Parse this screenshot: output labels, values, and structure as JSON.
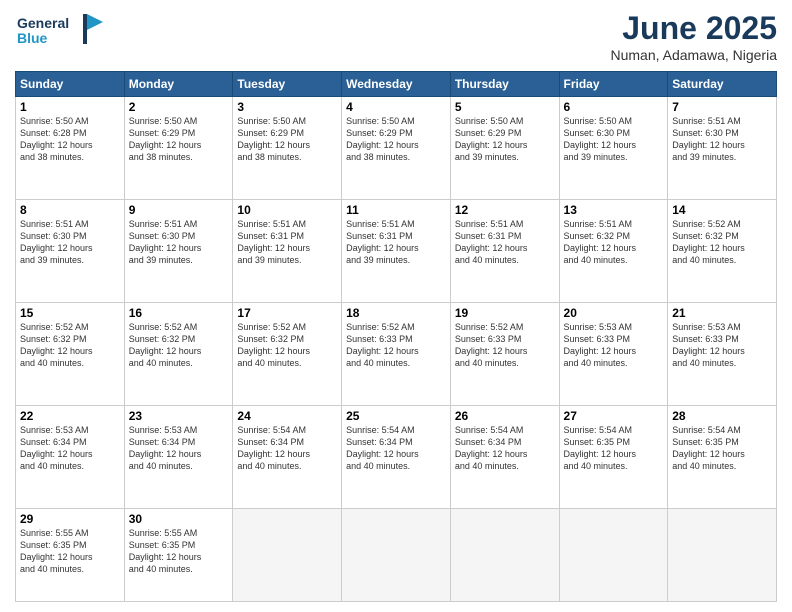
{
  "header": {
    "logo_line1": "General",
    "logo_line2": "Blue",
    "month_year": "June 2025",
    "location": "Numan, Adamawa, Nigeria"
  },
  "weekdays": [
    "Sunday",
    "Monday",
    "Tuesday",
    "Wednesday",
    "Thursday",
    "Friday",
    "Saturday"
  ],
  "weeks": [
    [
      {
        "day": "1",
        "detail": "Sunrise: 5:50 AM\nSunset: 6:28 PM\nDaylight: 12 hours\nand 38 minutes."
      },
      {
        "day": "2",
        "detail": "Sunrise: 5:50 AM\nSunset: 6:29 PM\nDaylight: 12 hours\nand 38 minutes."
      },
      {
        "day": "3",
        "detail": "Sunrise: 5:50 AM\nSunset: 6:29 PM\nDaylight: 12 hours\nand 38 minutes."
      },
      {
        "day": "4",
        "detail": "Sunrise: 5:50 AM\nSunset: 6:29 PM\nDaylight: 12 hours\nand 38 minutes."
      },
      {
        "day": "5",
        "detail": "Sunrise: 5:50 AM\nSunset: 6:29 PM\nDaylight: 12 hours\nand 39 minutes."
      },
      {
        "day": "6",
        "detail": "Sunrise: 5:50 AM\nSunset: 6:30 PM\nDaylight: 12 hours\nand 39 minutes."
      },
      {
        "day": "7",
        "detail": "Sunrise: 5:51 AM\nSunset: 6:30 PM\nDaylight: 12 hours\nand 39 minutes."
      }
    ],
    [
      {
        "day": "8",
        "detail": "Sunrise: 5:51 AM\nSunset: 6:30 PM\nDaylight: 12 hours\nand 39 minutes."
      },
      {
        "day": "9",
        "detail": "Sunrise: 5:51 AM\nSunset: 6:30 PM\nDaylight: 12 hours\nand 39 minutes."
      },
      {
        "day": "10",
        "detail": "Sunrise: 5:51 AM\nSunset: 6:31 PM\nDaylight: 12 hours\nand 39 minutes."
      },
      {
        "day": "11",
        "detail": "Sunrise: 5:51 AM\nSunset: 6:31 PM\nDaylight: 12 hours\nand 39 minutes."
      },
      {
        "day": "12",
        "detail": "Sunrise: 5:51 AM\nSunset: 6:31 PM\nDaylight: 12 hours\nand 40 minutes."
      },
      {
        "day": "13",
        "detail": "Sunrise: 5:51 AM\nSunset: 6:32 PM\nDaylight: 12 hours\nand 40 minutes."
      },
      {
        "day": "14",
        "detail": "Sunrise: 5:52 AM\nSunset: 6:32 PM\nDaylight: 12 hours\nand 40 minutes."
      }
    ],
    [
      {
        "day": "15",
        "detail": "Sunrise: 5:52 AM\nSunset: 6:32 PM\nDaylight: 12 hours\nand 40 minutes."
      },
      {
        "day": "16",
        "detail": "Sunrise: 5:52 AM\nSunset: 6:32 PM\nDaylight: 12 hours\nand 40 minutes."
      },
      {
        "day": "17",
        "detail": "Sunrise: 5:52 AM\nSunset: 6:32 PM\nDaylight: 12 hours\nand 40 minutes."
      },
      {
        "day": "18",
        "detail": "Sunrise: 5:52 AM\nSunset: 6:33 PM\nDaylight: 12 hours\nand 40 minutes."
      },
      {
        "day": "19",
        "detail": "Sunrise: 5:52 AM\nSunset: 6:33 PM\nDaylight: 12 hours\nand 40 minutes."
      },
      {
        "day": "20",
        "detail": "Sunrise: 5:53 AM\nSunset: 6:33 PM\nDaylight: 12 hours\nand 40 minutes."
      },
      {
        "day": "21",
        "detail": "Sunrise: 5:53 AM\nSunset: 6:33 PM\nDaylight: 12 hours\nand 40 minutes."
      }
    ],
    [
      {
        "day": "22",
        "detail": "Sunrise: 5:53 AM\nSunset: 6:34 PM\nDaylight: 12 hours\nand 40 minutes."
      },
      {
        "day": "23",
        "detail": "Sunrise: 5:53 AM\nSunset: 6:34 PM\nDaylight: 12 hours\nand 40 minutes."
      },
      {
        "day": "24",
        "detail": "Sunrise: 5:54 AM\nSunset: 6:34 PM\nDaylight: 12 hours\nand 40 minutes."
      },
      {
        "day": "25",
        "detail": "Sunrise: 5:54 AM\nSunset: 6:34 PM\nDaylight: 12 hours\nand 40 minutes."
      },
      {
        "day": "26",
        "detail": "Sunrise: 5:54 AM\nSunset: 6:34 PM\nDaylight: 12 hours\nand 40 minutes."
      },
      {
        "day": "27",
        "detail": "Sunrise: 5:54 AM\nSunset: 6:35 PM\nDaylight: 12 hours\nand 40 minutes."
      },
      {
        "day": "28",
        "detail": "Sunrise: 5:54 AM\nSunset: 6:35 PM\nDaylight: 12 hours\nand 40 minutes."
      }
    ],
    [
      {
        "day": "29",
        "detail": "Sunrise: 5:55 AM\nSunset: 6:35 PM\nDaylight: 12 hours\nand 40 minutes."
      },
      {
        "day": "30",
        "detail": "Sunrise: 5:55 AM\nSunset: 6:35 PM\nDaylight: 12 hours\nand 40 minutes."
      },
      {
        "day": "",
        "detail": ""
      },
      {
        "day": "",
        "detail": ""
      },
      {
        "day": "",
        "detail": ""
      },
      {
        "day": "",
        "detail": ""
      },
      {
        "day": "",
        "detail": ""
      }
    ]
  ]
}
